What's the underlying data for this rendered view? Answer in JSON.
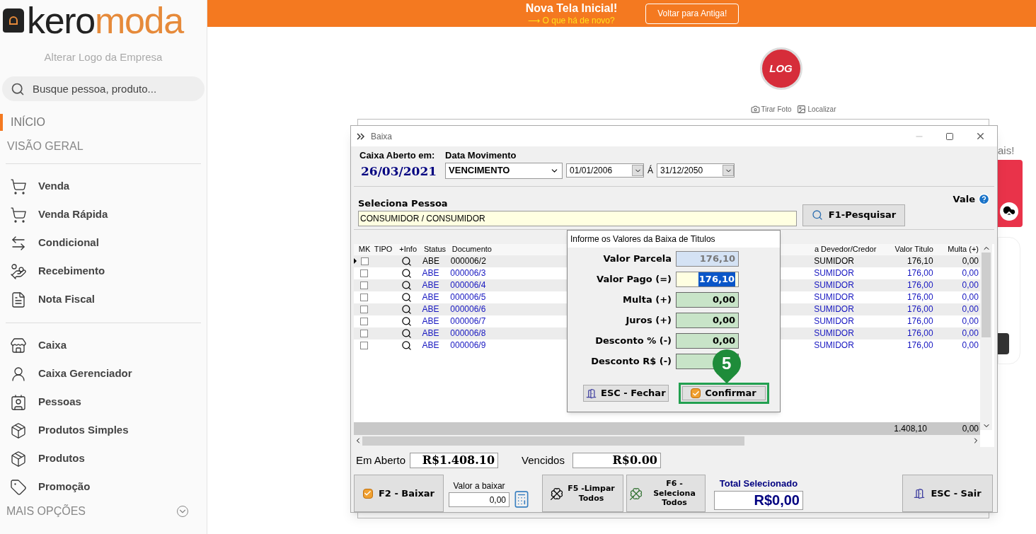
{
  "sidebar": {
    "logo": {
      "part_1": "kero",
      "part_2": "moda"
    },
    "change_logo": "Alterar Logo da Empresa",
    "search": {
      "placeholder": "Busque pessoa, produto..."
    },
    "sections": [
      {
        "label": "INÍCIO",
        "selected": true
      },
      {
        "label": "VISÃO GERAL",
        "selected": false
      }
    ],
    "groups": [
      [
        {
          "label": "Venda"
        },
        {
          "label": "Venda Rápida"
        },
        {
          "label": "Condicional"
        },
        {
          "label": "Recebimento"
        },
        {
          "label": "Nota Fiscal"
        }
      ],
      [
        {
          "label": "Caixa"
        },
        {
          "label": "Caixa Gerenciador"
        },
        {
          "label": "Pessoas"
        },
        {
          "label": "Produtos Simples"
        },
        {
          "label": "Produtos"
        },
        {
          "label": "Promoção"
        }
      ]
    ],
    "more": "MAIS OPÇÕES"
  },
  "banner": {
    "title": "Nova Tela Inicial!",
    "link": "⟶ O que há de novo?",
    "button": "Voltar para Antiga!"
  },
  "company": {
    "logo_text": "LOG",
    "take_photo": "Tirar Foto",
    "locate": "Localizar",
    "side_text": "ais!"
  },
  "window": {
    "title": "Baixa",
    "cash_label": "Caixa Aberto em:",
    "cash_date": "26/03/2021",
    "movement_label": "Data Movimento",
    "movement": "VENCIMENTO",
    "date_from": "01/01/2006",
    "date_sep": "Á",
    "date_to": "31/12/2050",
    "person_label": "Seleciona Pessoa",
    "person": "CONSUMIDOR / CONSUMIDOR",
    "search_button": "F1-Pesquisar",
    "vale": "Vale",
    "table": {
      "columns": [
        "MK",
        "TIPO",
        "+Info",
        "Status",
        "Documento",
        "a Devedor/Credor",
        "Valor Titulo",
        "Multa (+)"
      ],
      "rows": [
        {
          "checked": false,
          "selected": true,
          "status": "ABE",
          "document": "000006/2",
          "person": "SUMIDOR",
          "value": "176,10",
          "fine": "0,00"
        },
        {
          "checked": false,
          "selected": false,
          "status": "ABE",
          "document": "000006/3",
          "person": "SUMIDOR",
          "value": "176,00",
          "fine": "0,00"
        },
        {
          "checked": false,
          "selected": false,
          "status": "ABE",
          "document": "000006/4",
          "person": "SUMIDOR",
          "value": "176,00",
          "fine": "0,00"
        },
        {
          "checked": false,
          "selected": false,
          "status": "ABE",
          "document": "000006/5",
          "person": "SUMIDOR",
          "value": "176,00",
          "fine": "0,00"
        },
        {
          "checked": false,
          "selected": false,
          "status": "ABE",
          "document": "000006/6",
          "person": "SUMIDOR",
          "value": "176,00",
          "fine": "0,00"
        },
        {
          "checked": false,
          "selected": false,
          "status": "ABE",
          "document": "000006/7",
          "person": "SUMIDOR",
          "value": "176,00",
          "fine": "0,00"
        },
        {
          "checked": false,
          "selected": false,
          "status": "ABE",
          "document": "000006/8",
          "person": "SUMIDOR",
          "value": "176,00",
          "fine": "0,00"
        },
        {
          "checked": false,
          "selected": false,
          "status": "ABE",
          "document": "000006/9",
          "person": "SUMIDOR",
          "value": "176,00",
          "fine": "0,00"
        }
      ],
      "totals": {
        "value": "1.408,10",
        "fine": "0,00"
      }
    },
    "open_label": "Em Aberto",
    "open_value": "R$1.408.10",
    "overdue_label": "Vencidos",
    "overdue_value": "R$0.00",
    "buttons": {
      "baixar": "F2 - Baixar",
      "amount_label": "Valor a baixar",
      "amount": "0,00",
      "clear": "F5 -Limpar Todos",
      "select_all": "F6 - Seleciona Todos",
      "total_label": "Total Selecionado",
      "total": "R$0,00",
      "exit": "ESC - Sair"
    }
  },
  "dialog": {
    "title": "Informe os Valores da Baixa de Titulos",
    "fields": [
      {
        "label": "Valor Parcela",
        "value": "176,10",
        "kind": "readonly"
      },
      {
        "label": "Valor Pago (=)",
        "value": "176,10",
        "kind": "editing"
      },
      {
        "label": "Multa (+)",
        "value": "0,00",
        "kind": "amount"
      },
      {
        "label": "Juros (+)",
        "value": "0,00",
        "kind": "amount"
      },
      {
        "label": "Desconto % (-)",
        "value": "0,00",
        "kind": "amount"
      },
      {
        "label": "Desconto R$ (-)",
        "kind": "amount"
      }
    ],
    "close": "ESC - Fechar",
    "confirm": "Confirmar",
    "highlighted": true,
    "step": "5"
  }
}
